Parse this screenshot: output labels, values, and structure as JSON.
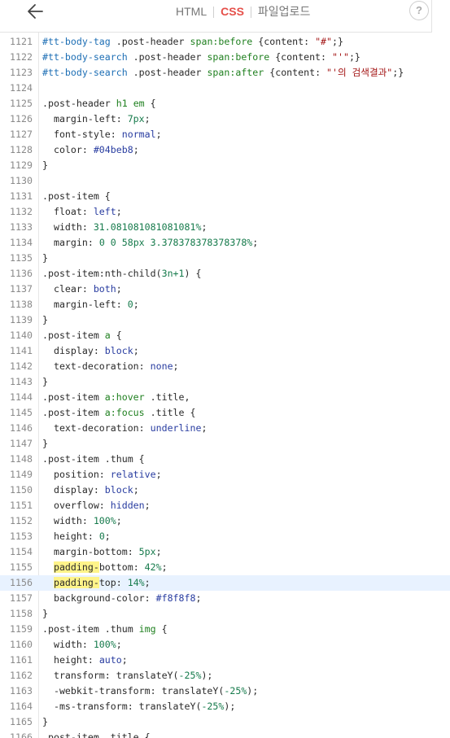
{
  "toolbar": {
    "tabs": [
      {
        "label": "HTML",
        "active": false
      },
      {
        "label": "CSS",
        "active": true
      },
      {
        "label": "파일업로드",
        "active": false
      }
    ],
    "help_label": "?",
    "accent_color": "#e5504a"
  },
  "editor": {
    "lines": [
      {
        "n": "1121",
        "parts": [
          [
            "#tt-body-tag",
            "id"
          ],
          [
            " .post-header ",
            ""
          ],
          [
            "span:before",
            "tag"
          ],
          [
            " {content: ",
            ""
          ],
          [
            "\"#\"",
            "str"
          ],
          [
            ";}",
            ""
          ]
        ]
      },
      {
        "n": "1122",
        "parts": [
          [
            "#tt-body-search",
            "id"
          ],
          [
            " .post-header ",
            ""
          ],
          [
            "span:before",
            "tag"
          ],
          [
            " {content: ",
            ""
          ],
          [
            "\"'\"",
            "str"
          ],
          [
            ";}",
            ""
          ]
        ]
      },
      {
        "n": "1123",
        "parts": [
          [
            "#tt-body-search",
            "id"
          ],
          [
            " .post-header ",
            ""
          ],
          [
            "span:after",
            "tag"
          ],
          [
            " {content: ",
            ""
          ],
          [
            "\"'의 검색결과\"",
            "str"
          ],
          [
            ";}",
            ""
          ]
        ]
      },
      {
        "n": "1124",
        "parts": []
      },
      {
        "n": "1125",
        "parts": [
          [
            ".post-header ",
            ""
          ],
          [
            "h1 em",
            "tag"
          ],
          [
            " {",
            ""
          ]
        ]
      },
      {
        "n": "1126",
        "parts": [
          [
            "  margin-left: ",
            ""
          ],
          [
            "7px",
            "num"
          ],
          [
            ";",
            ""
          ]
        ]
      },
      {
        "n": "1127",
        "parts": [
          [
            "  font-style: ",
            ""
          ],
          [
            "normal",
            "val"
          ],
          [
            ";",
            ""
          ]
        ]
      },
      {
        "n": "1128",
        "parts": [
          [
            "  color: ",
            ""
          ],
          [
            "#04beb8",
            "val"
          ],
          [
            ";",
            ""
          ]
        ]
      },
      {
        "n": "1129",
        "parts": [
          [
            "}",
            ""
          ]
        ]
      },
      {
        "n": "1130",
        "parts": []
      },
      {
        "n": "1131",
        "parts": [
          [
            ".post-item {",
            ""
          ]
        ]
      },
      {
        "n": "1132",
        "parts": [
          [
            "  float: ",
            ""
          ],
          [
            "left",
            "val"
          ],
          [
            ";",
            ""
          ]
        ]
      },
      {
        "n": "1133",
        "parts": [
          [
            "  width: ",
            ""
          ],
          [
            "31.081081081081081%",
            "num"
          ],
          [
            ";",
            ""
          ]
        ]
      },
      {
        "n": "1134",
        "parts": [
          [
            "  margin: ",
            ""
          ],
          [
            "0 0 58px 3.378378378378378%",
            "num"
          ],
          [
            ";",
            ""
          ]
        ]
      },
      {
        "n": "1135",
        "parts": [
          [
            "}",
            ""
          ]
        ]
      },
      {
        "n": "1136",
        "parts": [
          [
            ".post-item:nth-child(",
            ""
          ],
          [
            "3n+1",
            "num"
          ],
          [
            ") {",
            ""
          ]
        ]
      },
      {
        "n": "1137",
        "parts": [
          [
            "  clear: ",
            ""
          ],
          [
            "both",
            "val"
          ],
          [
            ";",
            ""
          ]
        ]
      },
      {
        "n": "1138",
        "parts": [
          [
            "  margin-left: ",
            ""
          ],
          [
            "0",
            "num"
          ],
          [
            ";",
            ""
          ]
        ]
      },
      {
        "n": "1139",
        "parts": [
          [
            "}",
            ""
          ]
        ]
      },
      {
        "n": "1140",
        "parts": [
          [
            ".post-item ",
            ""
          ],
          [
            "a",
            "tag"
          ],
          [
            " {",
            ""
          ]
        ]
      },
      {
        "n": "1141",
        "parts": [
          [
            "  display: ",
            ""
          ],
          [
            "block",
            "val"
          ],
          [
            ";",
            ""
          ]
        ]
      },
      {
        "n": "1142",
        "parts": [
          [
            "  text-decoration: ",
            ""
          ],
          [
            "none",
            "val"
          ],
          [
            ";",
            ""
          ]
        ]
      },
      {
        "n": "1143",
        "parts": [
          [
            "}",
            ""
          ]
        ]
      },
      {
        "n": "1144",
        "parts": [
          [
            ".post-item ",
            ""
          ],
          [
            "a:hover",
            "tag"
          ],
          [
            " .title,",
            ""
          ]
        ]
      },
      {
        "n": "1145",
        "parts": [
          [
            ".post-item ",
            ""
          ],
          [
            "a:focus",
            "tag"
          ],
          [
            " .title {",
            ""
          ]
        ]
      },
      {
        "n": "1146",
        "parts": [
          [
            "  text-decoration: ",
            ""
          ],
          [
            "underline",
            "val"
          ],
          [
            ";",
            ""
          ]
        ]
      },
      {
        "n": "1147",
        "parts": [
          [
            "}",
            ""
          ]
        ]
      },
      {
        "n": "1148",
        "parts": [
          [
            ".post-item .thum {",
            ""
          ]
        ]
      },
      {
        "n": "1149",
        "parts": [
          [
            "  position: ",
            ""
          ],
          [
            "relative",
            "val"
          ],
          [
            ";",
            ""
          ]
        ]
      },
      {
        "n": "1150",
        "parts": [
          [
            "  display: ",
            ""
          ],
          [
            "block",
            "val"
          ],
          [
            ";",
            ""
          ]
        ]
      },
      {
        "n": "1151",
        "parts": [
          [
            "  overflow: ",
            ""
          ],
          [
            "hidden",
            "val"
          ],
          [
            ";",
            ""
          ]
        ]
      },
      {
        "n": "1152",
        "parts": [
          [
            "  width: ",
            ""
          ],
          [
            "100%",
            "num"
          ],
          [
            ";",
            ""
          ]
        ]
      },
      {
        "n": "1153",
        "parts": [
          [
            "  height: ",
            ""
          ],
          [
            "0",
            "num"
          ],
          [
            ";",
            ""
          ]
        ]
      },
      {
        "n": "1154",
        "parts": [
          [
            "  margin-bottom: ",
            ""
          ],
          [
            "5px",
            "num"
          ],
          [
            ";",
            ""
          ]
        ]
      },
      {
        "n": "1155",
        "parts": [
          [
            "  ",
            ""
          ],
          [
            "padding-",
            "hl"
          ],
          [
            "bottom: ",
            ""
          ],
          [
            "42%",
            "num"
          ],
          [
            ";",
            ""
          ]
        ]
      },
      {
        "n": "1156",
        "active": true,
        "parts": [
          [
            "  ",
            ""
          ],
          [
            "padding-",
            "hl"
          ],
          [
            "top: ",
            ""
          ],
          [
            "14%",
            "num"
          ],
          [
            ";",
            ""
          ]
        ]
      },
      {
        "n": "1157",
        "parts": [
          [
            "  background-color: ",
            ""
          ],
          [
            "#f8f8f8",
            "val"
          ],
          [
            ";",
            ""
          ]
        ]
      },
      {
        "n": "1158",
        "parts": [
          [
            "}",
            ""
          ]
        ]
      },
      {
        "n": "1159",
        "parts": [
          [
            ".post-item .thum ",
            ""
          ],
          [
            "img",
            "tag"
          ],
          [
            " {",
            ""
          ]
        ]
      },
      {
        "n": "1160",
        "parts": [
          [
            "  width: ",
            ""
          ],
          [
            "100%",
            "num"
          ],
          [
            ";",
            ""
          ]
        ]
      },
      {
        "n": "1161",
        "parts": [
          [
            "  height: ",
            ""
          ],
          [
            "auto",
            "val"
          ],
          [
            ";",
            ""
          ]
        ]
      },
      {
        "n": "1162",
        "parts": [
          [
            "  transform: translateY(",
            ""
          ],
          [
            "-25%",
            "num"
          ],
          [
            ");",
            ""
          ]
        ]
      },
      {
        "n": "1163",
        "parts": [
          [
            "  -webkit-transform: translateY(",
            ""
          ],
          [
            "-25%",
            "num"
          ],
          [
            ");",
            ""
          ]
        ]
      },
      {
        "n": "1164",
        "parts": [
          [
            "  -ms-transform: translateY(",
            ""
          ],
          [
            "-25%",
            "num"
          ],
          [
            ");",
            ""
          ]
        ]
      },
      {
        "n": "1165",
        "parts": [
          [
            "}",
            ""
          ]
        ]
      },
      {
        "n": "1166",
        "parts": [
          [
            ".post-item .title {",
            ""
          ]
        ]
      }
    ]
  }
}
